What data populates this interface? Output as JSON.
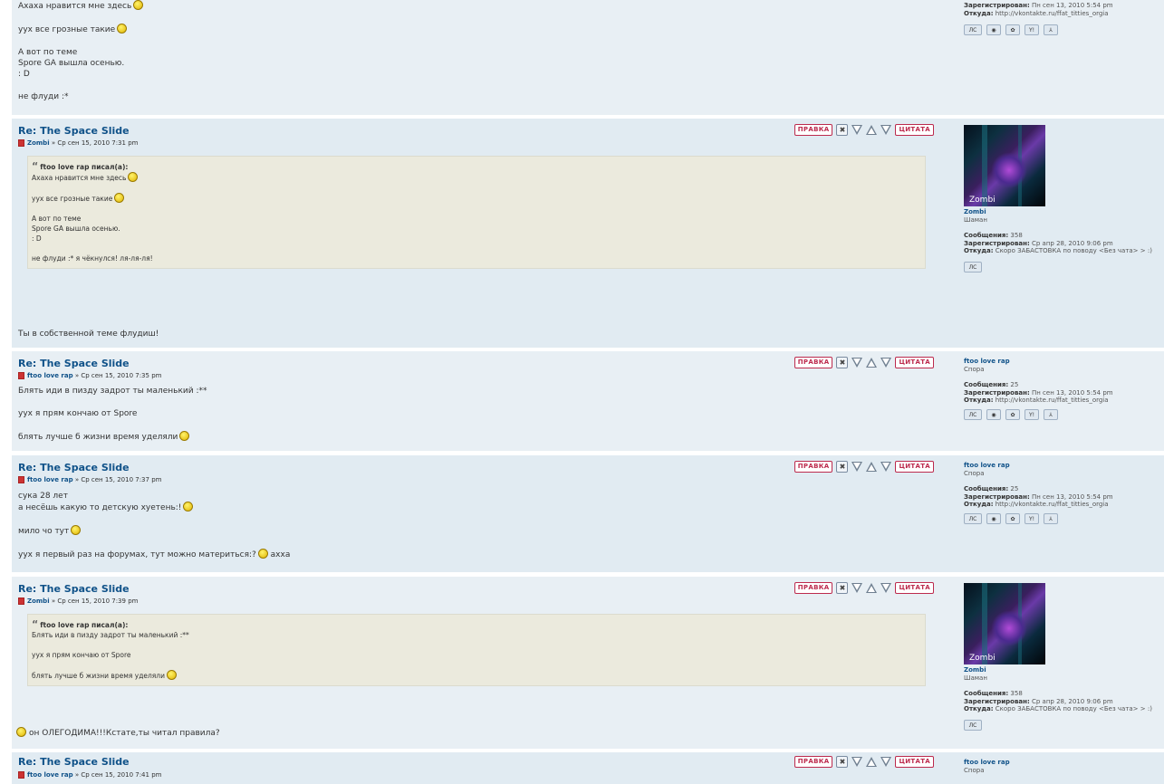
{
  "buttons": {
    "edit": "ПРАВКА",
    "quote": "ЦИТАТА"
  },
  "profile_labels": {
    "posts": "Сообщения:",
    "registered": "Зарегистрирован:",
    "from": "Откуда:",
    "pm": "ЛС"
  },
  "post0": {
    "lines": [
      "Ахаха нравится мне здесь",
      "",
      "уух все грозные такие",
      "",
      "А вот по теме",
      "Spore GA вышла осенью.",
      ": D",
      "",
      "не флуди :*"
    ],
    "profile": {
      "registered": "Пн сен 13, 2010 5:54 pm",
      "from": "http://vkontakte.ru/ffat_titties_orgia"
    }
  },
  "posts": [
    {
      "title": "Re: The Space Slide",
      "author": "Zombi",
      "date": "» Ср сен 15, 2010 7:31 pm",
      "quote": {
        "head": "ftoo love rap писал(а):",
        "lines": [
          "Ахаха нравится мне здесь",
          "",
          "уух все грозные такие",
          "",
          "А вот по теме",
          "Spore GA вышла осенью.",
          ": D",
          "",
          "не флуди :* я чёкнулся! ля-ля-ля!"
        ]
      },
      "lines": [
        "Ты в собственной теме флудиш!"
      ],
      "profile": {
        "name": "Zombi",
        "rank": "Шаман",
        "posts": "358",
        "registered": "Ср апр 28, 2010 9:06 pm",
        "from": "Скоро ЗАБАСТОВКА по поводу <Без чата> > :)",
        "avatar_caption": "Zombi"
      }
    },
    {
      "title": "Re: The Space Slide",
      "author": "ftoo love rap",
      "date": "» Ср сен 15, 2010 7:35 pm",
      "lines": [
        "Блять иди в  пизду задрот ты маленький :**",
        "",
        "уух я прям кончаю от Spore",
        "",
        "блять лучше б жизни время уделяли"
      ],
      "profile": {
        "name": "ftoo love rap",
        "rank": "Спора",
        "posts": "25",
        "registered": "Пн сен 13, 2010 5:54 pm",
        "from": "http://vkontakte.ru/ffat_titties_orgia"
      }
    },
    {
      "title": "Re: The Space Slide",
      "author": "ftoo love rap",
      "date": "» Ср сен 15, 2010 7:37 pm",
      "lines": [
        "сука 28 лет",
        "а несёшь какую то детскую хуетень:!",
        "",
        "мило чо тут",
        "",
        "уух я первый раз на форумах, тут можно материться:?",
        "ахха"
      ],
      "profile": {
        "name": "ftoo love rap",
        "rank": "Спора",
        "posts": "25",
        "registered": "Пн сен 13, 2010 5:54 pm",
        "from": "http://vkontakte.ru/ffat_titties_orgia"
      }
    },
    {
      "title": "Re: The Space Slide",
      "author": "Zombi",
      "date": "» Ср сен 15, 2010 7:39 pm",
      "quote": {
        "head": "ftoo love rap писал(а):",
        "lines": [
          "Блять иди в пизду задрот ты маленький :**",
          "",
          "уух я прям кончаю от Spore",
          "",
          "блять лучше б жизни время уделяли"
        ]
      },
      "lines": [
        "он ОЛЕГОДИМА!!!Кстате,ты читал правила?"
      ],
      "profile": {
        "name": "Zombi",
        "rank": "Шаман",
        "posts": "358",
        "registered": "Ср апр 28, 2010 9:06 pm",
        "from": "Скоро ЗАБАСТОВКА по поводу <Без чата> > :)",
        "avatar_caption": "Zombi"
      }
    },
    {
      "title": "Re: The Space Slide",
      "author": "ftoo love rap",
      "date": "» Ср сен 15, 2010 7:41 pm",
      "profile": {
        "name": "ftoo love rap",
        "rank": "Спора"
      }
    }
  ]
}
